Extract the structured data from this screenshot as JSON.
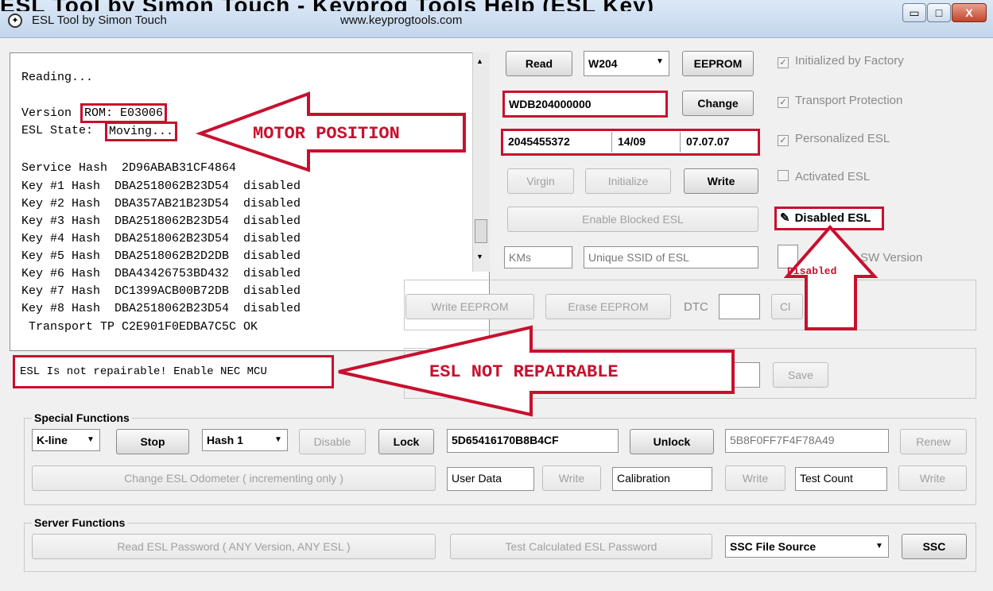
{
  "headline": "ESL Tool by Simon Touch - Keyprog Tools Help (ESL Key)",
  "window": {
    "title": "ESL Tool by Simon Touch",
    "url": "www.keyprogtools.com",
    "minimize": "▭",
    "maximize": "□",
    "close": "X"
  },
  "log": {
    "reading": "Reading...",
    "version_label": "Version ",
    "version_value": "ROM: E03006",
    "state_label": "ESL State: ",
    "state_value": "Moving...",
    "service_hash": "Service Hash  2D96ABAB31CF4864",
    "keys": [
      "Key #1 Hash  DBA2518062B23D54  disabled",
      "Key #2 Hash  DBA357AB21B23D54  disabled",
      "Key #3 Hash  DBA2518062B23D54  disabled",
      "Key #4 Hash  DBA2518062B23D54  disabled",
      "Key #5 Hash  DBA2518062B2D2DB  disabled",
      "Key #6 Hash  DBA43426753BD432  disabled",
      "Key #7 Hash  DC1399ACB00B72DB  disabled",
      "Key #8 Hash  DBA2518062B23D54  disabled"
    ],
    "transport": " Transport TP C2E901F0EDBA7C5C OK",
    "not_repairable": "ESL Is not repairable! Enable NEC MCU"
  },
  "controls": {
    "read": "Read",
    "model_select": "W204",
    "eeprom": "EEPROM",
    "vin": "WDB204000000",
    "change": "Change",
    "part_number": "2045455372",
    "date": "14/09",
    "version_date": "07.07.07",
    "virgin": "Virgin",
    "initialize": "Initialize",
    "write": "Write",
    "enable_blocked": "Enable Blocked ESL",
    "kms_placeholder": "KMs",
    "ssid_placeholder": "Unique SSID of ESL",
    "sw_version": "SW Version",
    "write_eeprom": "Write EEPROM",
    "erase_eeprom": "Erase EEPROM",
    "dtc": "DTC",
    "clear": "Cl",
    "save": "Save"
  },
  "checks": {
    "initialized": "Initialized by Factory",
    "transport": "Transport Protection",
    "personalized": "Personalized ESL",
    "activated": "Activated ESL",
    "disabled": "Disabled ESL"
  },
  "special": {
    "legend": "Special Functions",
    "kline": "K-line",
    "stop": "Stop",
    "hash": "Hash 1",
    "disable": "Disable",
    "lock": "Lock",
    "lock_code": "5D65416170B8B4CF",
    "unlock": "Unlock",
    "unlock_code": "5B8F0FF7F4F78A49",
    "renew": "Renew",
    "odometer": "Change ESL Odometer ( incrementing only )",
    "user_data": "User Data",
    "write1": "Write",
    "calibration": "Calibration",
    "write2": "Write",
    "test_count": "Test Count",
    "write3": "Write"
  },
  "server": {
    "legend": "Server Functions",
    "read_password": "Read ESL Password ( ANY Version, ANY ESL )",
    "test_password": "Test Calculated ESL Password",
    "source": "SSC File Source",
    "ssc": "SSC"
  },
  "annotations": {
    "motor": "MOTOR POSITION",
    "repair": "ESL NOT REPAIRABLE",
    "disabled": "Disabled"
  },
  "colors": {
    "annotation_red": "#c8102e",
    "window_bg": "#f0f0f0"
  }
}
